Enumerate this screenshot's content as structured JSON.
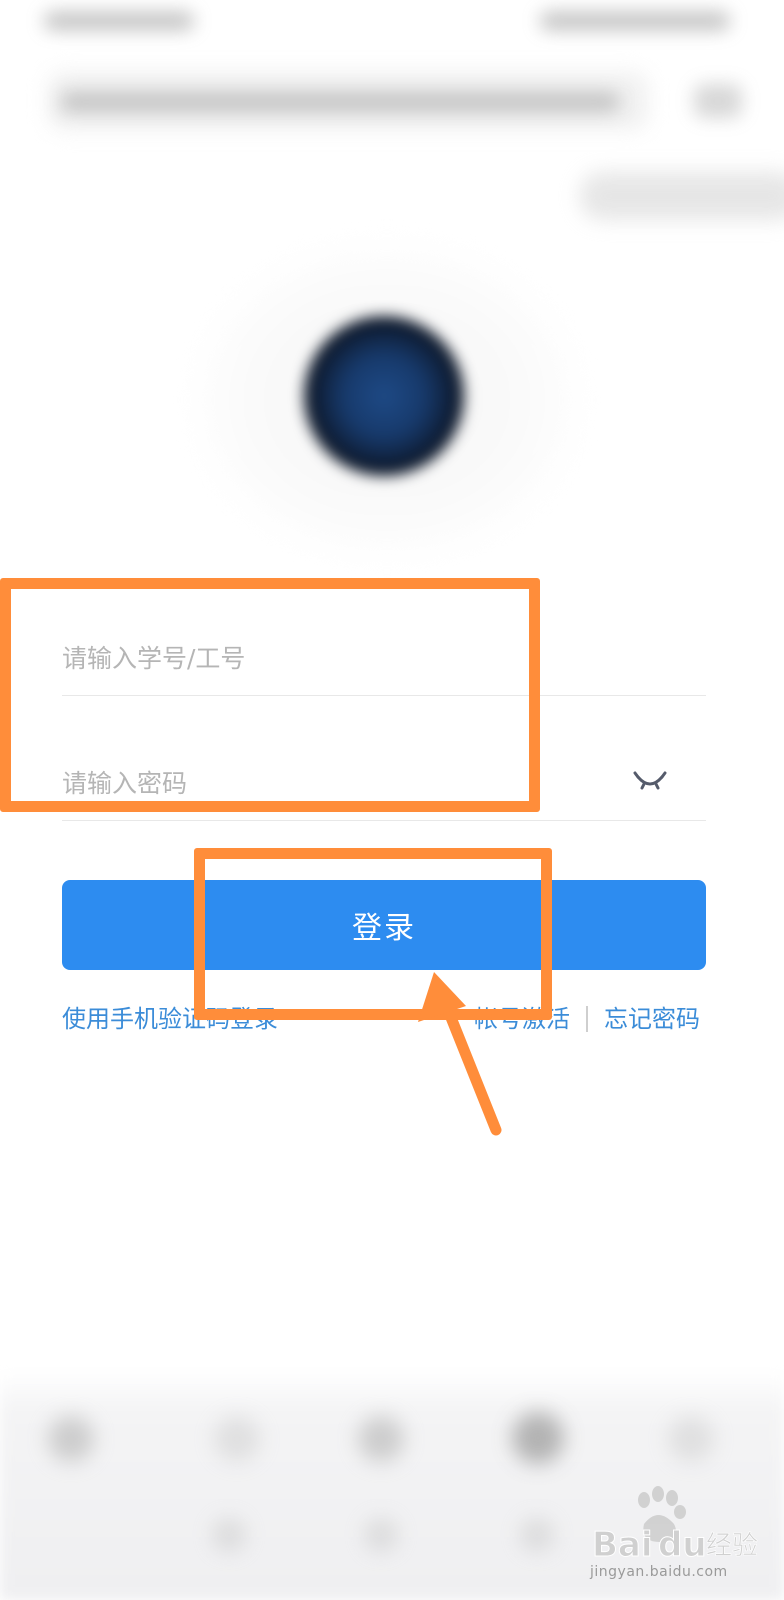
{
  "login_form": {
    "account_placeholder": "请输入学号/工号",
    "password_placeholder": "请输入密码",
    "password_toggle_icon": "eye-closed-icon",
    "login_button_label": "登录"
  },
  "links": {
    "sms_login": "使用手机验证码登录",
    "activate_account": "帐号激活",
    "divider": "|",
    "forgot_password": "忘记密码"
  },
  "logo": {
    "icon": "school-logo-icon"
  },
  "annotations": {
    "color": "#ff8d3a"
  },
  "watermark": {
    "brand": "Baidu经验",
    "caption": "jingyan.baidu.com"
  },
  "colors": {
    "primary": "#2d8cf0",
    "link": "#3b8cd8",
    "placeholder": "#b5b5b5"
  }
}
